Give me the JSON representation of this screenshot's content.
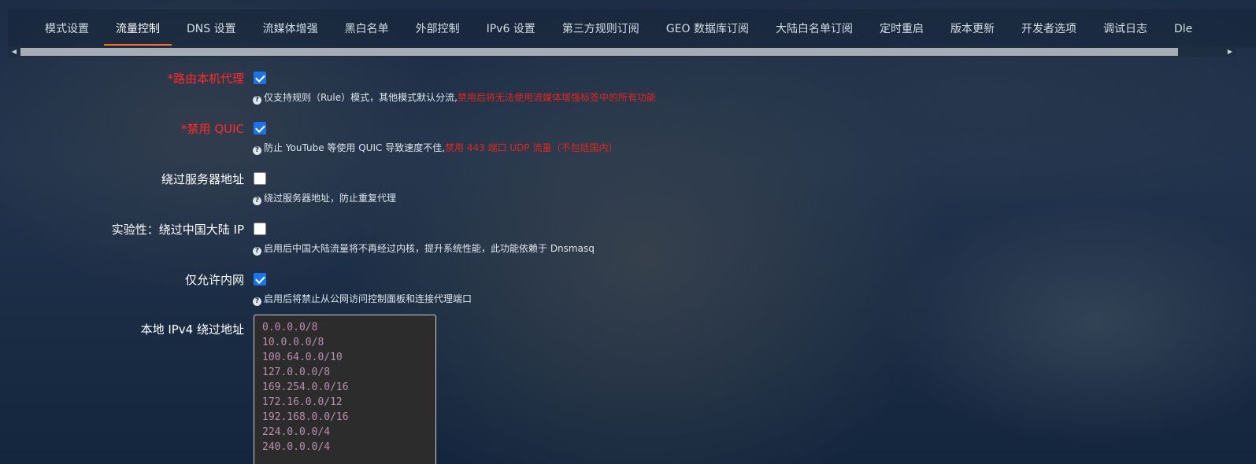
{
  "tabs": [
    {
      "label": "模式设置",
      "active": false
    },
    {
      "label": "流量控制",
      "active": true
    },
    {
      "label": "DNS 设置",
      "active": false
    },
    {
      "label": "流媒体增强",
      "active": false
    },
    {
      "label": "黑白名单",
      "active": false
    },
    {
      "label": "外部控制",
      "active": false
    },
    {
      "label": "IPv6 设置",
      "active": false
    },
    {
      "label": "第三方规则订阅",
      "active": false
    },
    {
      "label": "GEO 数据库订阅",
      "active": false
    },
    {
      "label": "大陆白名单订阅",
      "active": false
    },
    {
      "label": "定时重启",
      "active": false
    },
    {
      "label": "版本更新",
      "active": false
    },
    {
      "label": "开发者选项",
      "active": false
    },
    {
      "label": "调试日志",
      "active": false
    },
    {
      "label": "Dle",
      "active": false
    }
  ],
  "colors": {
    "accent": "#ff6a2c",
    "checkbox": "#1d74e8",
    "required": "#ff2a2a",
    "warning": "#e0281f"
  },
  "fields": {
    "route_local": {
      "label": "*路由本机代理",
      "checked": true,
      "hint": "仅支持规则（Rule）模式，其他模式默认分流,",
      "hint_warn": "禁用后将无法使用流媒体增强标签中的所有功能"
    },
    "disable_quic": {
      "label": "*禁用 QUIC",
      "checked": true,
      "hint": "防止 YouTube 等使用 QUIC 导致速度不佳,",
      "hint_warn": "禁用 443 端口 UDP 流量（不包括国内）"
    },
    "bypass_server": {
      "label": "绕过服务器地址",
      "checked": false,
      "hint": "绕过服务器地址，防止重复代理"
    },
    "bypass_cn": {
      "label": "实验性：绕过中国大陆 IP",
      "checked": false,
      "hint": "启用后中国大陆流量将不再经过内核，提升系统性能，此功能依赖于 Dnsmasq"
    },
    "lan_only": {
      "label": "仅允许内网",
      "checked": true,
      "hint": "启用后将禁止从公网访问控制面板和连接代理端口"
    },
    "ipv4_bypass": {
      "label": "本地 IPv4 绕过地址",
      "value": "0.0.0.0/8\n10.0.0.0/8\n100.64.0.0/10\n127.0.0.0/8\n169.254.0.0/16\n172.16.0.0/12\n192.168.0.0/16\n224.0.0.0/4\n240.0.0.0/4"
    }
  }
}
